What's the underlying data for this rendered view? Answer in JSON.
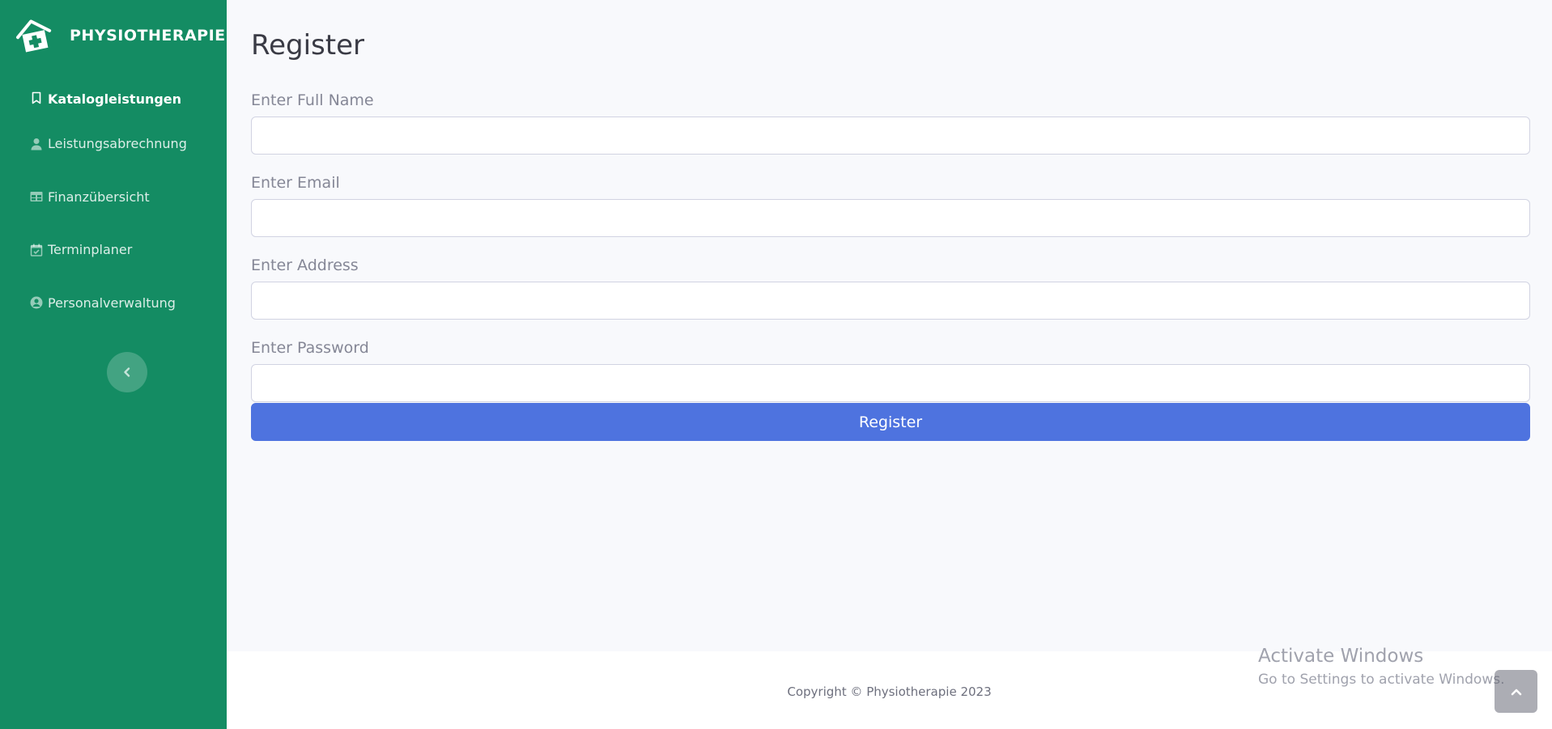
{
  "brand": {
    "name": "PHYSIOTHERAPIE",
    "icon": "clinic-house-icon"
  },
  "sidebar": {
    "items": [
      {
        "label": "Katalogleistungen",
        "icon": "bookmark-icon",
        "active": true
      },
      {
        "label": "Leistungsabrechnung",
        "icon": "user-icon",
        "active": false
      },
      {
        "label": "Finanzübersicht",
        "icon": "table-icon",
        "active": false
      },
      {
        "label": "Terminplaner",
        "icon": "calendar-check-icon",
        "active": false
      },
      {
        "label": "Personalverwaltung",
        "icon": "user-circle-icon",
        "active": false
      }
    ],
    "toggle_icon": "chevron-left-icon"
  },
  "page": {
    "title": "Register"
  },
  "form": {
    "full_name_label": "Enter Full Name",
    "full_name_value": "",
    "email_label": "Enter Email",
    "email_value": "",
    "address_label": "Enter Address",
    "address_value": "",
    "password_label": "Enter Password",
    "password_value": "",
    "submit_label": "Register"
  },
  "footer": {
    "copyright": "Copyright © Physiotherapie 2023"
  },
  "watermark": {
    "title": "Activate Windows",
    "subtitle": "Go to Settings to activate Windows."
  },
  "scroll_top_icon": "chevron-up-icon",
  "colors": {
    "sidebar_bg": "#148c63",
    "primary_button": "#4e73df",
    "page_bg": "#f8f9fc"
  }
}
